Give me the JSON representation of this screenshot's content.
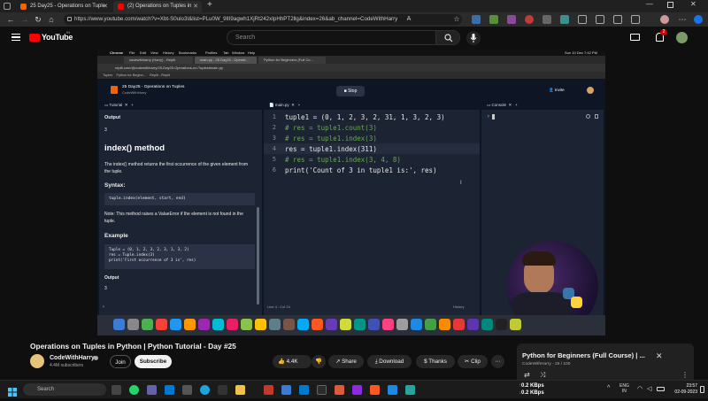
{
  "browser": {
    "tabs": [
      {
        "label": "25 Day25 - Operations on Tuple"
      },
      {
        "label": "(2) Operations on Tuples in"
      }
    ],
    "url": "https://www.youtube.com/watch?v=Xbt-S0ulo3I&list=PLu0W_9lII9agwh1XjRt242xIpHhPT2llg&index=26&ab_channel=CodeWithHarry"
  },
  "youtube": {
    "logo_text": "YouTube",
    "logo_region": "IN",
    "search_placeholder": "Search",
    "notification_count": "2"
  },
  "video": {
    "mac_menu": [
      "Chrome",
      "File",
      "Edit",
      "View",
      "History",
      "Bookmarks",
      "Profiles",
      "Tab",
      "Window",
      "Help"
    ],
    "mac_clock": "Sun 10 Dec  7:42 PM",
    "mac_tabs": [
      "codewithharry (Harry) - Replit",
      "main.py - 25 Day25 - Operati...",
      "Python for Beginners (Full Co..."
    ],
    "mac_url": "replit.com/@codewithharry/25-Day25-Operations-on-Tuples#main.py",
    "mac_bookmarks": [
      "Tuples",
      "Python for Beginn...",
      "Replit - Replit"
    ],
    "repl_title": "25 Day25 - Operations on Tuples",
    "repl_user": "CodeWithHarry",
    "stop_label": "Stop",
    "invite_label": "Invite",
    "tutorial_tab": "Tutorial",
    "editor_tab": "main.py",
    "console_tab": "Console",
    "tutorial": {
      "output_heading_1": "Output",
      "output_value_1": "3",
      "method_heading": "index() method",
      "method_desc": "The index() method returns the first occurrence of the given element from the tuple.",
      "syntax_heading": "Syntax:",
      "syntax_code": "tuple.index(element, start, end)",
      "note": "Note: This method raises a ValueError if the element is not found in the tuple.",
      "example_heading": "Example",
      "example_code": [
        "Tuple = (0, 1, 2, 3, 2, 3, 1, 3, 2)",
        "res = Tuple.index(3)",
        "print('First occurrence of 3 is', res)"
      ],
      "output_heading_2": "Output",
      "output_value_2": "3"
    },
    "code_lines": [
      "tuple1 = (0, 1, 2, 3, 2, 31, 1, 3, 2, 3)",
      "# res = tuple1.count(3)",
      "# res = tuple1.index(3)",
      "res = tuple1.index(311)",
      "# res = tuple1.index(3, 4, 8)",
      "print('Count of 3 in tuple1 is:', res)"
    ],
    "line_numbers": [
      "1",
      "2",
      "3",
      "4",
      "5",
      "6"
    ],
    "status_left": "Line 4 : Col 24",
    "status_right": "History",
    "console_prompt": "›"
  },
  "meta": {
    "title": "Operations on Tuples in Python | Python Tutorial - Day #25",
    "channel": "CodeWithHarry",
    "subscribers": "4.4M subscribers",
    "join_label": "Join",
    "subscribe_label": "Subscribe",
    "likes": "4.4K",
    "share_label": "Share",
    "download_label": "Download",
    "thanks_label": "Thanks",
    "clip_label": "Clip"
  },
  "playlist": {
    "title": "Python for Beginners (Full Course) | ...",
    "subtitle": "CodeWithHarry - 25 / 100"
  },
  "taskbar": {
    "search_placeholder": "Search",
    "net_up": "0.2 KBps",
    "net_down": "0.2 KBps",
    "lang_top": "ENG",
    "lang_bottom": "IN",
    "time": "23:57",
    "date": "02-09-2023"
  },
  "colors": {
    "accent_red": "#ff0000",
    "code_comment": "#6aa84f",
    "code_function": "#dcdcaa",
    "code_string": "#ce9178",
    "code_number": "#b5cea8",
    "replit_bg": "#1c2333"
  }
}
